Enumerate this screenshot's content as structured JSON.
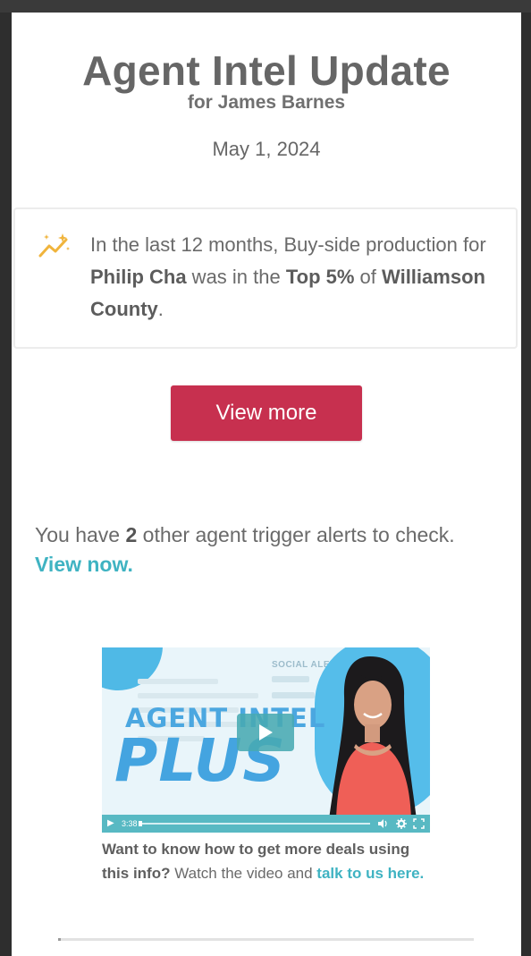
{
  "header": {
    "title": "Agent Intel Update",
    "recipient": "for James Barnes",
    "date": "May 1, 2024"
  },
  "insight_card": {
    "icon": "sparkle-trend-icon",
    "icon_color": "#f0b43c",
    "text_before_agent": "In the last 12 months, Buy-side production for ",
    "agent_name": "Philip Cha",
    "text_middle": " was in the ",
    "rank": "Top 5%",
    "text_before_county": " of ",
    "county": "Williamson County",
    "text_end": "."
  },
  "cta": {
    "label": "View more",
    "color": "#c7304f"
  },
  "alerts": {
    "prefix": "You have ",
    "count": "2",
    "suffix": " other agent trigger alerts to check.",
    "link_label": "View now."
  },
  "video": {
    "brand_line_1": "AGENT INTEL",
    "brand_line_2": "PLUS",
    "side_heading": "SOCIAL ALE",
    "duration": "3:38",
    "accent": "#58b9c3"
  },
  "caption": {
    "bold_question": "Want to know how to get more deals using this info?",
    "middle": " Watch the video and ",
    "link_label": "talk to us here."
  },
  "colors": {
    "link": "#3fb3c2",
    "text": "#6a6a6a"
  }
}
